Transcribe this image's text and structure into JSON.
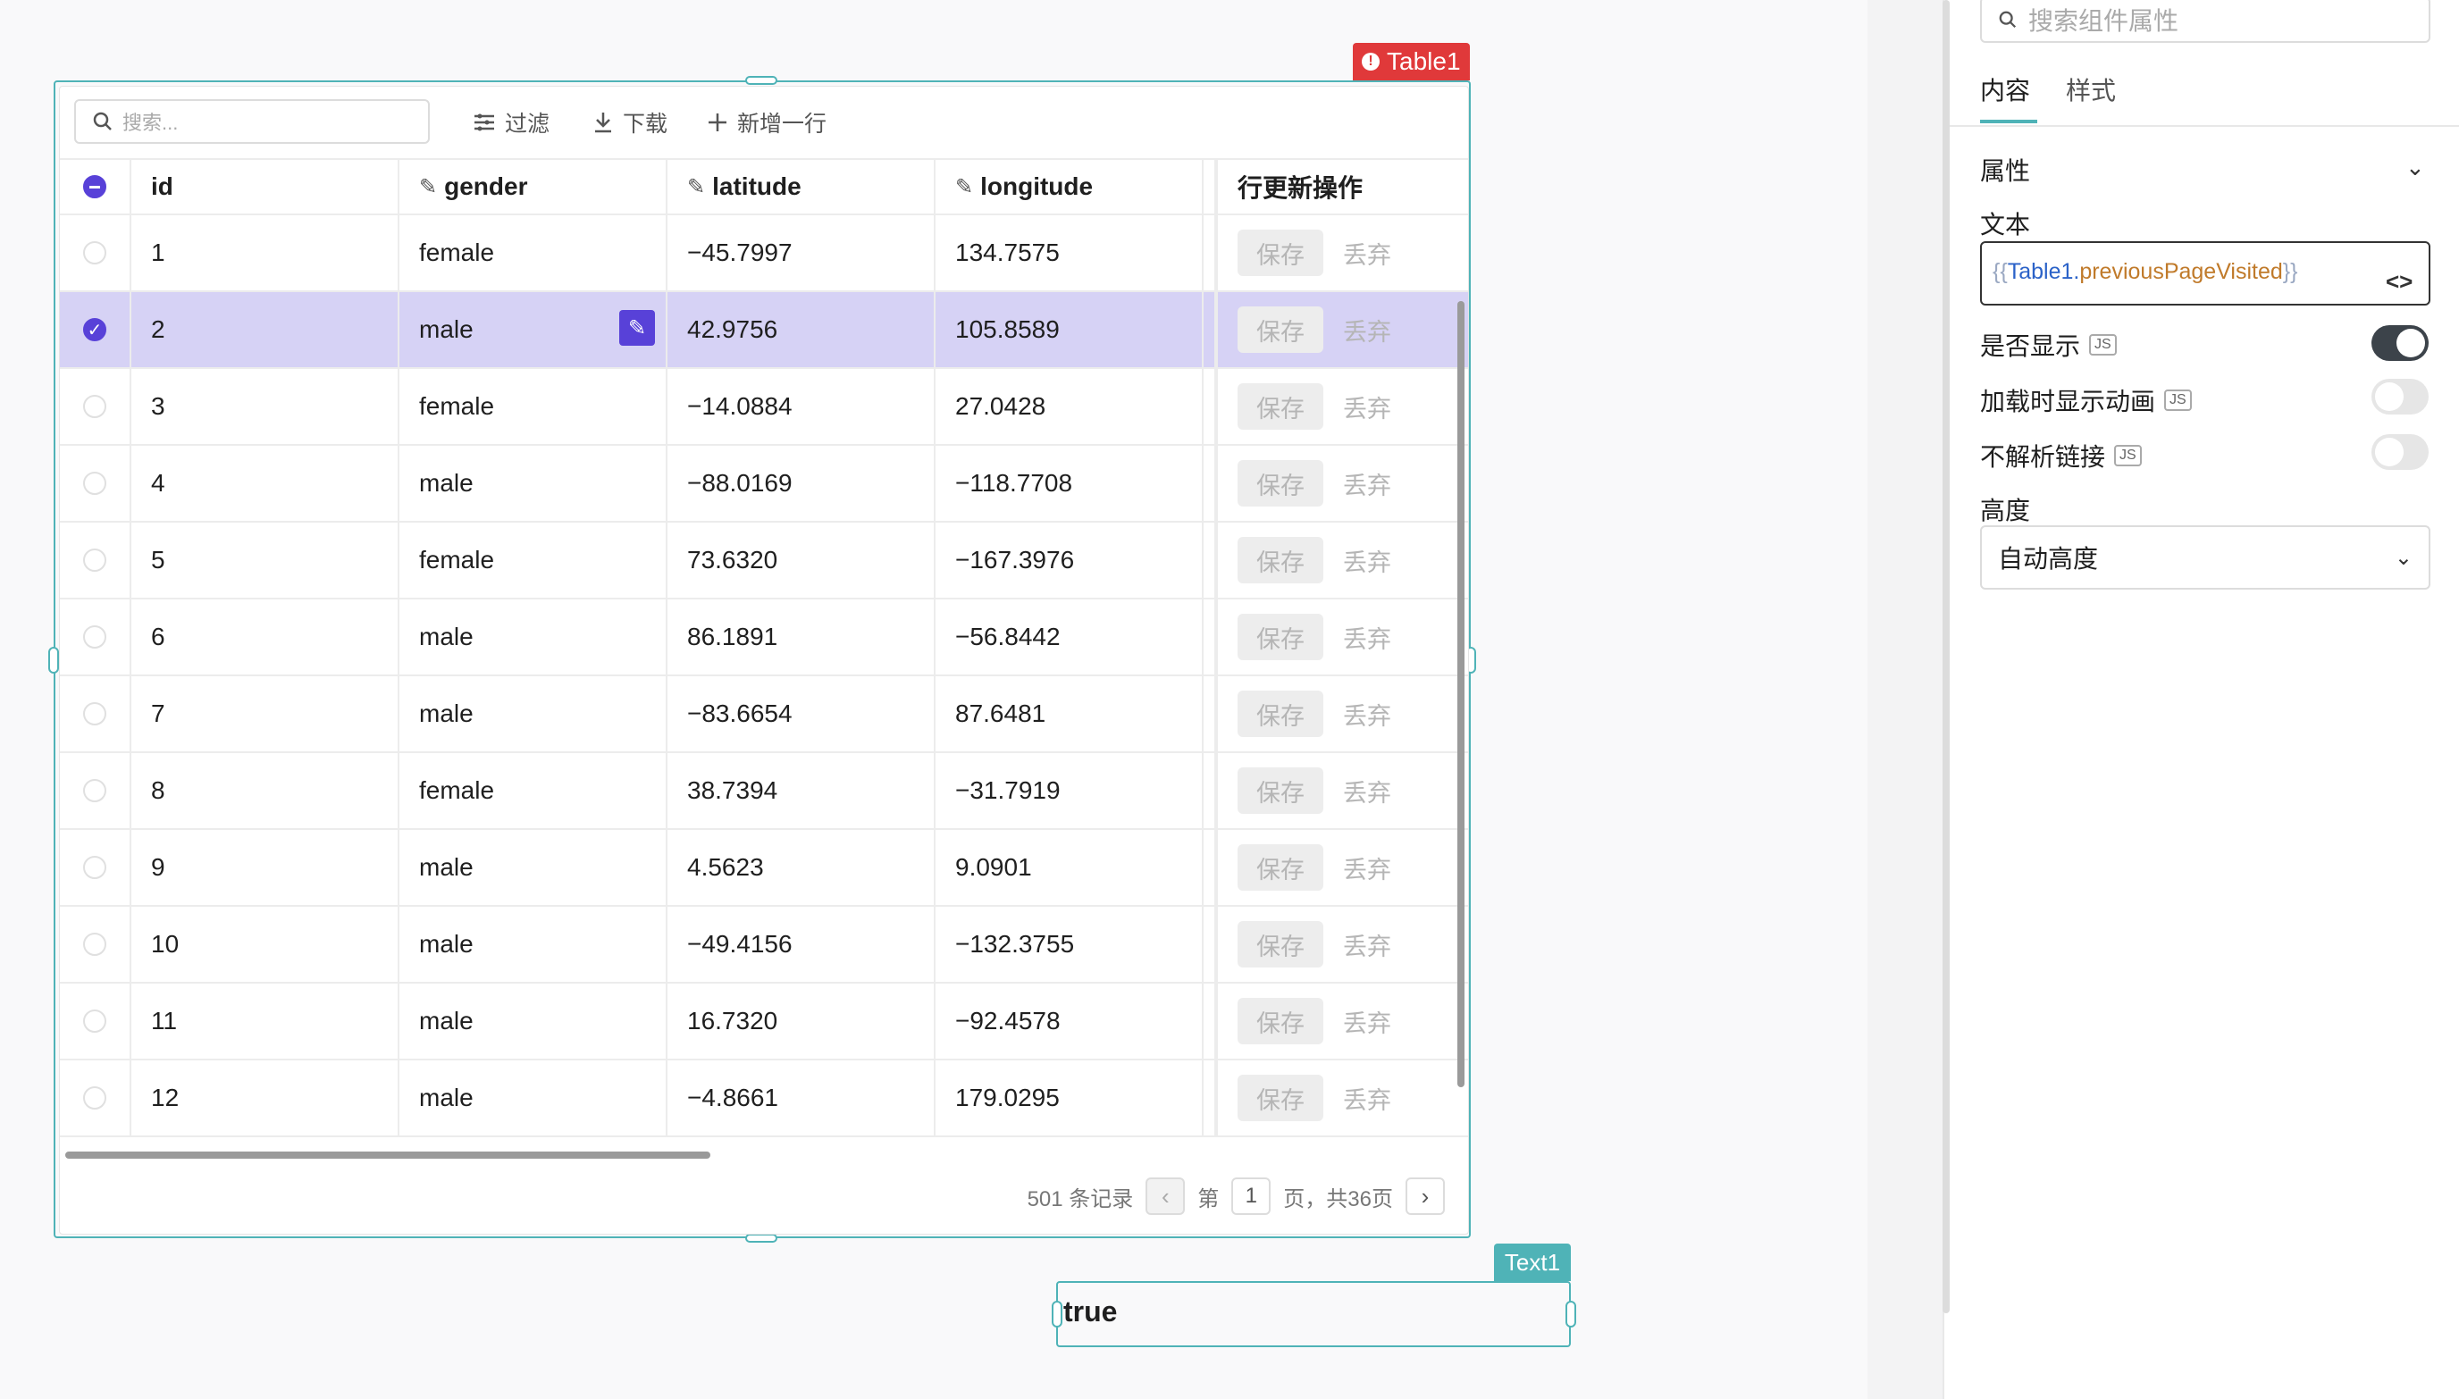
{
  "table_widget": {
    "name": "Table1",
    "search_placeholder": "搜索...",
    "toolbar": {
      "filter": "过滤",
      "download": "下载",
      "add_row": "新增一行"
    },
    "columns": [
      "id",
      "gender",
      "latitude",
      "longitude",
      "行更新操作"
    ],
    "save_label": "保存",
    "discard_label": "丢弃",
    "selected_row_index": 1,
    "rows": [
      {
        "id": "1",
        "gender": "female",
        "latitude": "−45.7997",
        "longitude": "134.7575"
      },
      {
        "id": "2",
        "gender": "male",
        "latitude": "42.9756",
        "longitude": "105.8589"
      },
      {
        "id": "3",
        "gender": "female",
        "latitude": "−14.0884",
        "longitude": "27.0428"
      },
      {
        "id": "4",
        "gender": "male",
        "latitude": "−88.0169",
        "longitude": "−118.7708"
      },
      {
        "id": "5",
        "gender": "female",
        "latitude": "73.6320",
        "longitude": "−167.3976"
      },
      {
        "id": "6",
        "gender": "male",
        "latitude": "86.1891",
        "longitude": "−56.8442"
      },
      {
        "id": "7",
        "gender": "male",
        "latitude": "−83.6654",
        "longitude": "87.6481"
      },
      {
        "id": "8",
        "gender": "female",
        "latitude": "38.7394",
        "longitude": "−31.7919"
      },
      {
        "id": "9",
        "gender": "male",
        "latitude": "4.5623",
        "longitude": "9.0901"
      },
      {
        "id": "10",
        "gender": "male",
        "latitude": "−49.4156",
        "longitude": "−132.3755"
      },
      {
        "id": "11",
        "gender": "male",
        "latitude": "16.7320",
        "longitude": "−92.4578"
      },
      {
        "id": "12",
        "gender": "male",
        "latitude": "−4.8661",
        "longitude": "179.0295"
      }
    ],
    "pagination": {
      "record_count": "501 条记录",
      "page_prefix": "第",
      "current_page": "1",
      "page_suffix": "页，共36页"
    }
  },
  "text_widget": {
    "name": "Text1",
    "value": "true"
  },
  "properties_panel": {
    "search_placeholder": "搜索组件属性",
    "tabs": [
      "内容",
      "样式"
    ],
    "active_tab": 0,
    "section_title": "属性",
    "text_label": "文本",
    "text_binding": {
      "open": "{{",
      "object": "Table1",
      "dot": ".",
      "property": "previousPageVisited",
      "close": "}}"
    },
    "visible_label": "是否显示",
    "visible_on": true,
    "loading_anim_label": "加载时显示动画",
    "loading_anim_on": false,
    "no_parse_links_label": "不解析链接",
    "no_parse_links_on": false,
    "js_badge": "JS",
    "height_label": "高度",
    "height_value": "自动高度"
  },
  "colors": {
    "accent": "#5841d8",
    "widget_outline": "#4fb3b7",
    "error_tag": "#e0393a",
    "selected_row": "#d6d2f5"
  }
}
